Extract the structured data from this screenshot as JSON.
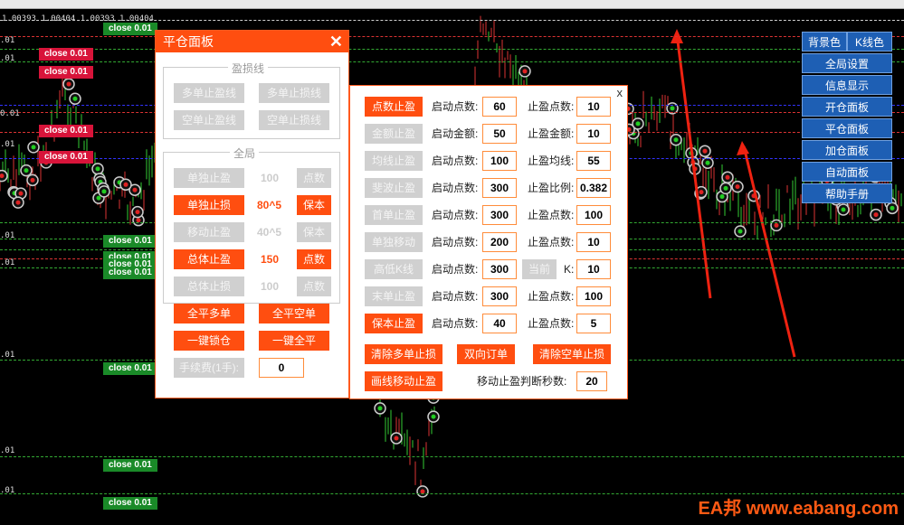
{
  "chart": {
    "ohlc_text": "1.00393 1.00404 1.00393 1.00404",
    "close_tags": [
      {
        "text": "close 0.01",
        "color": "green"
      },
      {
        "text": "close 0.01",
        "color": "red"
      },
      {
        "text": "close 0.01",
        "color": "red"
      },
      {
        "text": "close 0.01",
        "color": "red"
      },
      {
        "text": "close 0.01",
        "color": "red"
      },
      {
        "text": "close 0.01",
        "color": "green"
      },
      {
        "text": "close 0.01",
        "color": "green"
      },
      {
        "text": "close 0.01",
        "color": "green"
      },
      {
        "text": "close 0.01",
        "color": "green"
      },
      {
        "text": "close 0.01",
        "color": "green"
      },
      {
        "text": "close 0.01",
        "color": "green"
      },
      {
        "text": "close 0.01",
        "color": "green"
      }
    ],
    "price_labels": [
      ".01",
      ".01",
      "0.01",
      ".01",
      ".01",
      ".01",
      ".01",
      ".01",
      ".01"
    ]
  },
  "panel1": {
    "title": "平仓面板",
    "close": "✕",
    "group1_label": "盈损线",
    "group1_buttons": [
      "多单止盈线",
      "多单止损线",
      "空单止盈线",
      "空单止损线"
    ],
    "group2_label": "全局",
    "rows": [
      {
        "btn": "单独止盈",
        "btn_on": false,
        "value": "100",
        "value_ghost": true,
        "right": "点数",
        "right_on": false
      },
      {
        "btn": "单独止损",
        "btn_on": true,
        "value": "80^5",
        "value_ghost": false,
        "right": "保本",
        "right_on": true
      },
      {
        "btn": "移动止盈",
        "btn_on": false,
        "value": "40^5",
        "value_ghost": true,
        "right": "保本",
        "right_on": false
      },
      {
        "btn": "总体止盈",
        "btn_on": true,
        "value": "150",
        "value_ghost": false,
        "right": "点数",
        "right_on": true
      },
      {
        "btn": "总体止损",
        "btn_on": false,
        "value": "100",
        "value_ghost": true,
        "right": "点数",
        "right_on": false
      }
    ],
    "close_all_buy": "全平多单",
    "close_all_sell": "全平空单",
    "lock": "一键锁仓",
    "close_all": "一键全平",
    "fee_label": "手续费(1手):",
    "fee_value": "0"
  },
  "panel2": {
    "close": "x",
    "rows": [
      {
        "btn": "点数止盈",
        "on": true,
        "l1": "启动点数:",
        "v1": "60",
        "l2": "止盈点数:",
        "v2": "10"
      },
      {
        "btn": "金额止盈",
        "on": false,
        "l1": "启动金额:",
        "v1": "50",
        "l2": "止盈金额:",
        "v2": "10"
      },
      {
        "btn": "均线止盈",
        "on": false,
        "l1": "启动点数:",
        "v1": "100",
        "l2": "止盈均线:",
        "v2": "55"
      },
      {
        "btn": "斐波止盈",
        "on": false,
        "l1": "启动点数:",
        "v1": "300",
        "l2": "止盈比例:",
        "v2": "0.382"
      },
      {
        "btn": "首单止盈",
        "on": false,
        "l1": "启动点数:",
        "v1": "300",
        "l2": "止盈点数:",
        "v2": "100"
      },
      {
        "btn": "单独移动",
        "on": false,
        "l1": "启动点数:",
        "v1": "200",
        "l2": "止盈点数:",
        "v2": "10"
      },
      {
        "btn": "高低K线",
        "on": false,
        "l1": "启动点数:",
        "v1": "300",
        "l2": "K:",
        "v2": "10",
        "extra": "当前"
      },
      {
        "btn": "末单止盈",
        "on": false,
        "l1": "启动点数:",
        "v1": "300",
        "l2": "止盈点数:",
        "v2": "100"
      },
      {
        "btn": "保本止盈",
        "on": true,
        "l1": "启动点数:",
        "v1": "40",
        "l2": "止盈点数:",
        "v2": "5"
      }
    ],
    "clear_buy_sl": "清除多单止损",
    "bidirectional": "双向订单",
    "clear_sell_sl": "清除空单止损",
    "draw_trailing": "画线移动止盈",
    "trail_seconds_label": "移动止盈判断秒数:",
    "trail_seconds": "20"
  },
  "sidebar": {
    "bg_color": "背景色",
    "k_color": "K线色",
    "items": [
      "全局设置",
      "信息显示",
      "开仓面板",
      "平仓面板",
      "加仓面板",
      "自动面板",
      "帮助手册"
    ]
  },
  "watermark": "EA邦 www.eabang.com",
  "colors": {
    "accent": "#ff4e10",
    "sidebar": "#1e5fb4"
  }
}
